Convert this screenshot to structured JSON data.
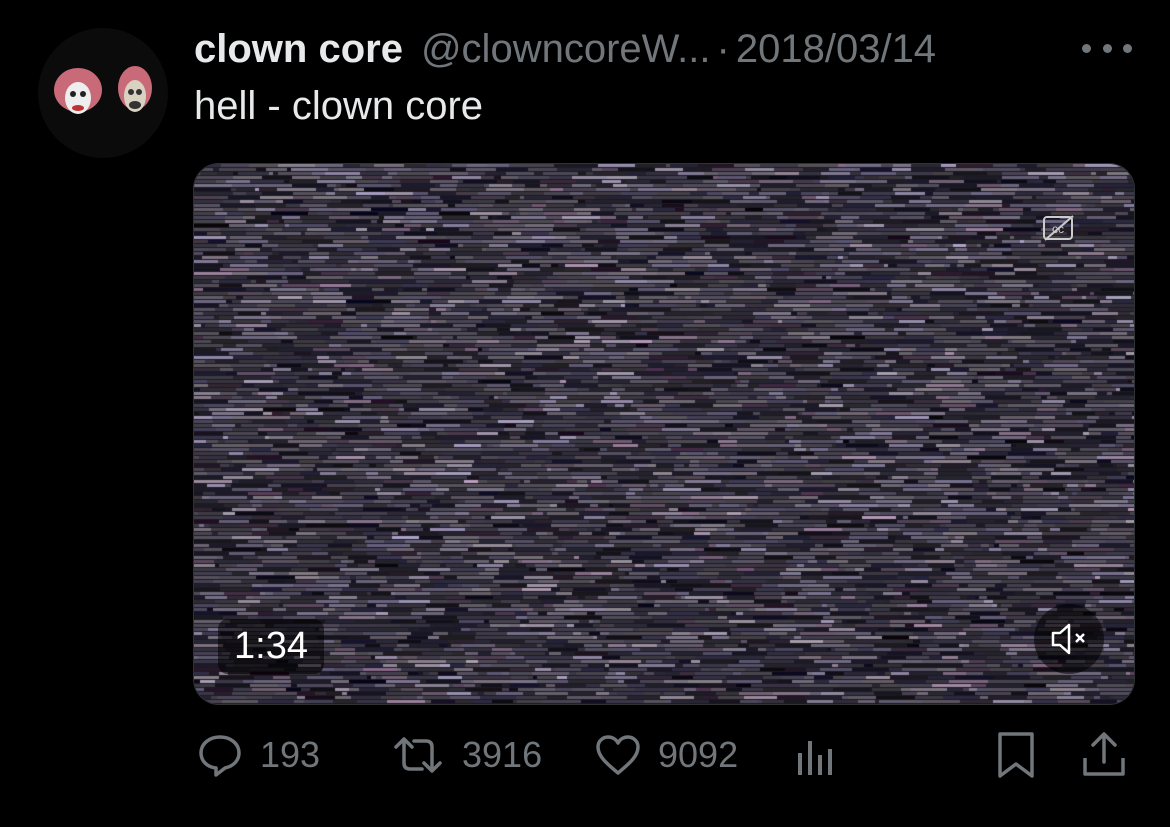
{
  "tweet": {
    "display_name": "clown core",
    "handle": "@clowncoreW...",
    "separator": "·",
    "date": "2018/03/14",
    "text": "hell - clown core"
  },
  "media": {
    "duration": "1:34"
  },
  "actions": {
    "replies": "193",
    "retweets": "3916",
    "likes": "9092"
  },
  "icons": [
    "more-icon",
    "cc-icon",
    "mute-icon",
    "reply-icon",
    "retweet-icon",
    "like-icon",
    "views-icon",
    "bookmark-icon",
    "share-icon"
  ],
  "colors": {
    "background": "#000000",
    "text": "#e7e9ea",
    "muted": "#71767b"
  }
}
